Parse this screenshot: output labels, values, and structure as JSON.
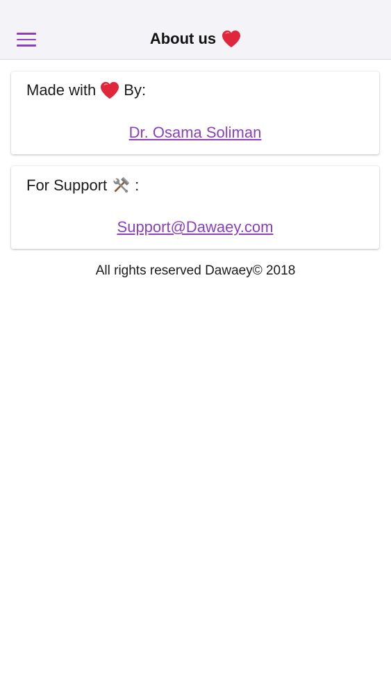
{
  "header": {
    "title": "About us",
    "title_icon": "heart-icon",
    "menu_icon": "hamburger-menu-icon"
  },
  "cards": [
    {
      "heading_before": "Made with",
      "heading_icon": "heart-icon",
      "heading_after": "By:",
      "link_text": "Dr. Osama Soliman"
    },
    {
      "heading_before": "For Support",
      "heading_icon": "hammer-wrench-icon",
      "heading_after": ":",
      "link_text": "Support@Dawaey.com"
    }
  ],
  "footer": {
    "text": "All rights reserved Dawaey© 2018"
  },
  "colors": {
    "accent": "#8a3fbf",
    "heart": "#e0263b",
    "header_bg": "#f4f3f7"
  }
}
